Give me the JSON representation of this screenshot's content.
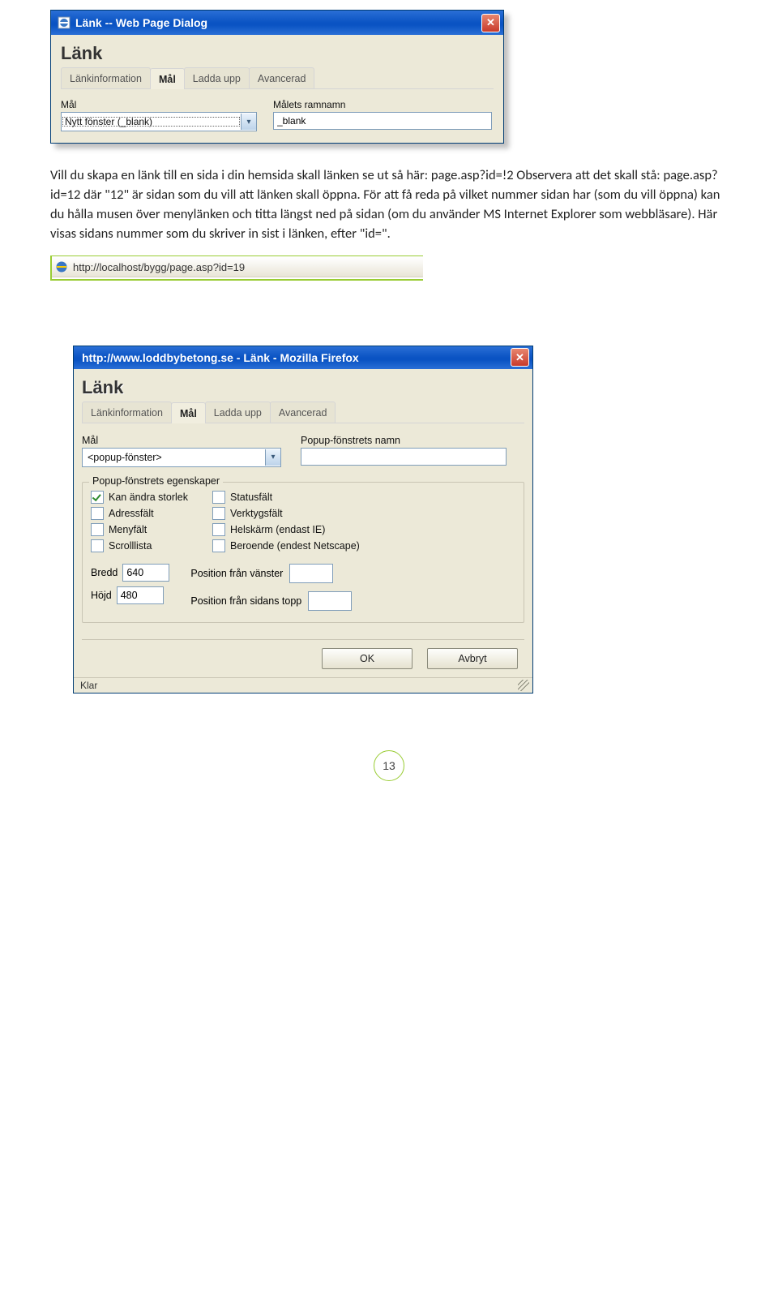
{
  "dialog1": {
    "windowTitle": "Länk -- Web Page Dialog",
    "heading": "Länk",
    "tabs": [
      "Länkinformation",
      "Mål",
      "Ladda upp",
      "Avancerad"
    ],
    "activeTab": 1,
    "targetLabel": "Mål",
    "targetValue": "Nytt fönster (_blank)",
    "frameLabel": "Målets ramnamn",
    "frameValue": "_blank"
  },
  "paragraph": "Vill du skapa en länk till en sida i din hemsida skall länken se ut så här: page.asp?id=!2 Observera att det skall stå: page.asp?id=12 där \"12\" är sidan som du vill att länken skall öppna. För att få reda på vilket nummer sidan har (som du vill öppna) kan du hålla musen över menylänken och titta längst ned på sidan (om du använder MS Internet Explorer som webbläsare). Här visas sidans nummer som du skriver in sist i länken, efter \"id=\".",
  "statusbar": {
    "url": "http://localhost/bygg/page.asp?id=19"
  },
  "dialog2": {
    "windowTitle": "http://www.loddbybetong.se - Länk - Mozilla Firefox",
    "heading": "Länk",
    "tabs": [
      "Länkinformation",
      "Mål",
      "Ladda upp",
      "Avancerad"
    ],
    "activeTab": 1,
    "targetLabel": "Mål",
    "targetValue": "<popup-fönster>",
    "popupNameLabel": "Popup-fönstrets namn",
    "popupNameValue": "",
    "groupTitle": "Popup-fönstrets egenskaper",
    "propsLeft": [
      {
        "label": "Kan ändra storlek",
        "checked": true
      },
      {
        "label": "Adressfält",
        "checked": false
      },
      {
        "label": "Menyfält",
        "checked": false
      },
      {
        "label": "Scrolllista",
        "checked": false
      }
    ],
    "propsRight": [
      {
        "label": "Statusfält",
        "checked": false
      },
      {
        "label": "Verktygsfält",
        "checked": false
      },
      {
        "label": "Helskärm (endast IE)",
        "checked": false
      },
      {
        "label": "Beroende (endest Netscape)",
        "checked": false
      }
    ],
    "widthLabel": "Bredd",
    "widthValue": "640",
    "heightLabel": "Höjd",
    "heightValue": "480",
    "posLeftLabel": "Position från vänster",
    "posTopLabel": "Position från sidans topp",
    "okLabel": "OK",
    "cancelLabel": "Avbryt",
    "status": "Klar"
  },
  "pageNumber": "13"
}
